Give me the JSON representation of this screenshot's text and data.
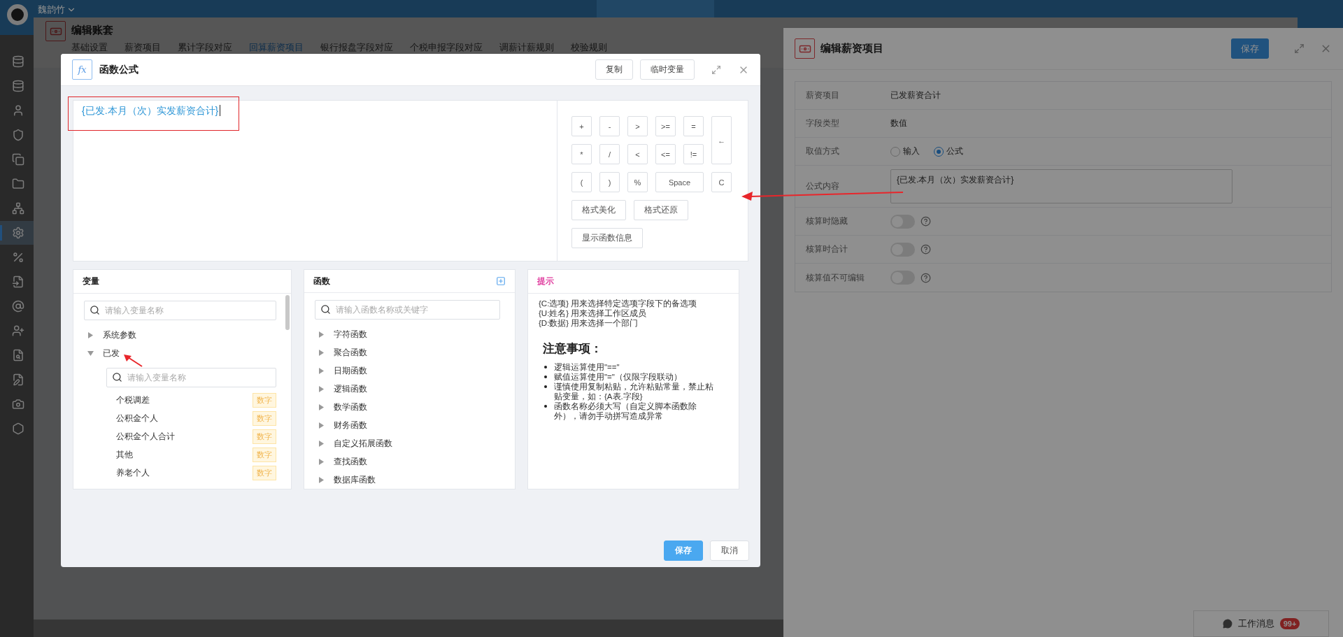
{
  "top_bar": {
    "user_name": "魏韵竹"
  },
  "sidebar": {
    "items": [
      {
        "selected": false
      },
      {
        "selected": false
      },
      {
        "selected": false
      },
      {
        "selected": false
      },
      {
        "selected": false
      },
      {
        "selected": false
      },
      {
        "selected": false
      },
      {
        "selected": true
      },
      {
        "selected": false
      },
      {
        "selected": false
      },
      {
        "selected": false
      },
      {
        "selected": false
      },
      {
        "selected": false
      },
      {
        "selected": false
      },
      {
        "selected": false
      },
      {
        "selected": false
      }
    ]
  },
  "account_editor": {
    "title": "编辑账套",
    "tabs": [
      {
        "label": "基础设置",
        "selected": false
      },
      {
        "label": "薪资项目",
        "selected": false
      },
      {
        "label": "累计字段对应",
        "selected": false
      },
      {
        "label": "回算薪资项目",
        "selected": true
      },
      {
        "label": "银行报盘字段对应",
        "selected": false
      },
      {
        "label": "个税申报字段对应",
        "selected": false
      },
      {
        "label": "调薪计薪规则",
        "selected": false
      },
      {
        "label": "校验规则",
        "selected": false
      }
    ]
  },
  "formula_dialog": {
    "icon_label": "fx",
    "title": "函数公式",
    "header_buttons": [
      "复制",
      "临时变量"
    ],
    "formula": "{已发.本月（次）实发薪资合计}",
    "operators": [
      {
        "label": "+",
        "kind": "key"
      },
      {
        "label": "-",
        "kind": "key"
      },
      {
        "label": ">",
        "kind": "key"
      },
      {
        "label": ">=",
        "kind": "key"
      },
      {
        "label": "=",
        "kind": "key"
      },
      {
        "label": "←",
        "kind": "tall"
      },
      {
        "label": "*",
        "kind": "key"
      },
      {
        "label": "/",
        "kind": "key"
      },
      {
        "label": "<",
        "kind": "key"
      },
      {
        "label": "<=",
        "kind": "key"
      },
      {
        "label": "!=",
        "kind": "key"
      },
      {
        "label": "(",
        "kind": "key"
      },
      {
        "label": ")",
        "kind": "key"
      },
      {
        "label": "%",
        "kind": "key"
      },
      {
        "label": "Space",
        "kind": "wide"
      },
      {
        "label": "C",
        "kind": "key"
      }
    ],
    "format_buttons": [
      "格式美化",
      "格式还原",
      "显示函数信息"
    ],
    "variables": {
      "title": "变量",
      "search_placeholder": "请输入变量名称",
      "tree": [
        {
          "label": "系统参数",
          "expanded": false
        },
        {
          "label": "已发",
          "expanded": true,
          "search_placeholder": "请输入变量名称",
          "children": [
            {
              "label": "个税调差",
              "tag": "数字"
            },
            {
              "label": "公积金个人",
              "tag": "数字"
            },
            {
              "label": "公积金个人合计",
              "tag": "数字"
            },
            {
              "label": "其他",
              "tag": "数字"
            },
            {
              "label": "养老个人",
              "tag": "数字"
            }
          ]
        }
      ]
    },
    "functions": {
      "title": "函数",
      "search_placeholder": "请输入函数名称或关键字",
      "groups": [
        {
          "label": "字符函数",
          "expanded": false
        },
        {
          "label": "聚合函数",
          "expanded": false
        },
        {
          "label": "日期函数",
          "expanded": false
        },
        {
          "label": "逻辑函数",
          "expanded": false
        },
        {
          "label": "数学函数",
          "expanded": false
        },
        {
          "label": "财务函数",
          "expanded": false
        },
        {
          "label": "自定义拓展函数",
          "expanded": false
        },
        {
          "label": "查找函数",
          "expanded": false
        },
        {
          "label": "数据库函数",
          "expanded": false
        }
      ]
    },
    "hints": {
      "title": "提示",
      "lines": [
        "{C:选项} 用来选择特定选项字段下的备选项",
        "{U:姓名} 用来选择工作区成员",
        "{D:数据} 用来选择一个部门"
      ],
      "notes_title": "注意事项：",
      "notes": [
        "逻辑运算使用\"==\"",
        "赋值运算使用\"=\"（仅限字段联动）",
        "谨慎使用复制粘贴，允许粘贴常量，禁止粘贴变量，如：{A表.字段}",
        "函数名称必须大写（自定义脚本函数除外），请勿手动拼写造成异常"
      ]
    },
    "footer_buttons": [
      {
        "label": "保存",
        "kind": "primary"
      },
      {
        "label": "取消",
        "kind": "default"
      }
    ]
  },
  "item_editor": {
    "title": "编辑薪资项目",
    "save_button": "保存",
    "fields": [
      {
        "kind": "text",
        "label": "薪资项目",
        "value": "已发薪资合计"
      },
      {
        "kind": "text",
        "label": "字段类型",
        "value": "数值"
      },
      {
        "kind": "radio",
        "label": "取值方式",
        "options": [
          {
            "label": "输入",
            "selected": false
          },
          {
            "label": "公式",
            "selected": true
          }
        ]
      },
      {
        "kind": "textarea",
        "label": "公式内容",
        "value": "{已发.本月（次）实发薪资合计}"
      },
      {
        "kind": "switch",
        "label": "核算时隐藏",
        "on": false
      },
      {
        "kind": "switch",
        "label": "核算时合计",
        "on": false
      },
      {
        "kind": "switch",
        "label": "核算值不可编辑",
        "on": false
      }
    ]
  },
  "message_widget": {
    "label": "工作消息",
    "badge": "99+"
  }
}
